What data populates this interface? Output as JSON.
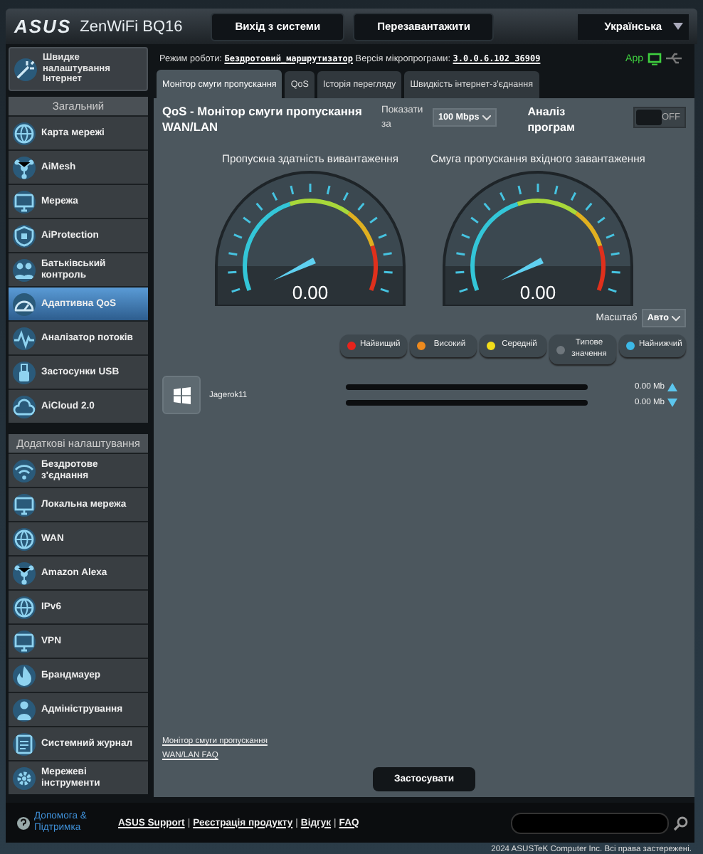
{
  "header": {
    "logo": "ASUS",
    "model": "ZenWiFi BQ16",
    "buttons": [
      "Вихід з системи",
      "Перезавантажити"
    ],
    "language": "Українська"
  },
  "status_line": {
    "mode_label": "Режим роботи:",
    "mode": "Бездротовий_маршрутизатор",
    "firmware_label": "Версія мікропрограми:",
    "firmware": "3.0.0.6.102_36909",
    "app_label": "App"
  },
  "sidebar": {
    "quick_setup": "Швидке налаштування Інтернет",
    "sections": [
      {
        "title": "Загальний",
        "items": [
          {
            "label": "Карта мережі",
            "selected": false
          },
          {
            "label": "AiMesh",
            "selected": false
          },
          {
            "label": "Мережа",
            "selected": false
          },
          {
            "label": "AiProtection",
            "selected": false
          },
          {
            "label": "Батьківський контроль",
            "selected": false
          },
          {
            "label": "Адаптивна QoS",
            "selected": true
          },
          {
            "label": "Аналізатор потоків",
            "selected": false
          },
          {
            "label": "Застосунки USB",
            "selected": false
          },
          {
            "label": "AiCloud 2.0",
            "selected": false
          }
        ]
      },
      {
        "title": "Додаткові налаштування",
        "items": [
          {
            "label": "Бездротове з'єднання",
            "selected": false
          },
          {
            "label": "Локальна мережа",
            "selected": false
          },
          {
            "label": "WAN",
            "selected": false
          },
          {
            "label": "Amazon Alexa",
            "selected": false
          },
          {
            "label": "IPv6",
            "selected": false
          },
          {
            "label": "VPN",
            "selected": false
          },
          {
            "label": "Брандмауер",
            "selected": false
          },
          {
            "label": "Адміністрування",
            "selected": false
          },
          {
            "label": "Системний журнал",
            "selected": false
          },
          {
            "label": "Мережеві інструменти",
            "selected": false
          }
        ]
      }
    ]
  },
  "tabs": [
    {
      "label": "Монітор смуги пропускання",
      "selected": true
    },
    {
      "label": "QoS",
      "selected": false
    },
    {
      "label": "Історія перегляду",
      "selected": false
    },
    {
      "label": "Швидкість інтернет-з'єднання",
      "selected": false
    }
  ],
  "qos": {
    "title": "QoS - Монітор смуги пропускання WAN/LAN",
    "show_label": "Показати за",
    "show_value": "100 Mbps",
    "analysis_label": "Аналіз програм",
    "analysis_on": false,
    "toggle_text": "OFF",
    "gauges": [
      {
        "title": "Пропускна здатність вивантаження",
        "value": "0.00"
      },
      {
        "title": "Смуга пропускання вхідного завантаження",
        "value": "0.00"
      }
    ],
    "scale_label": "Масштаб",
    "scale_value": "Авто",
    "priorities": [
      {
        "label": "Найвищий",
        "color": "#e8231c"
      },
      {
        "label": "Високий",
        "color": "#ee8a1d"
      },
      {
        "label": "Середній",
        "color": "#f2dd1a"
      },
      {
        "label": "Типове значення",
        "color": "#6e767c"
      },
      {
        "label": "Найнижчий",
        "color": "#3cb8e6"
      }
    ],
    "devices": [
      {
        "name": "Jagerok11",
        "upload": "0.00 Mb",
        "download": "0.00 Mb"
      }
    ],
    "links": [
      "Монітор смуги пропускання",
      "WAN/LAN FAQ"
    ],
    "apply": "Застосувати"
  },
  "footer": {
    "help": "Допомога & Підтримка",
    "links": [
      "ASUS Support",
      "Реєстрація продукту",
      "Відгук",
      "FAQ"
    ],
    "separators": [
      "|",
      "|",
      "|"
    ]
  },
  "copyright": "2024 ASUSTeK Computer Inc. Всі права застережені."
}
